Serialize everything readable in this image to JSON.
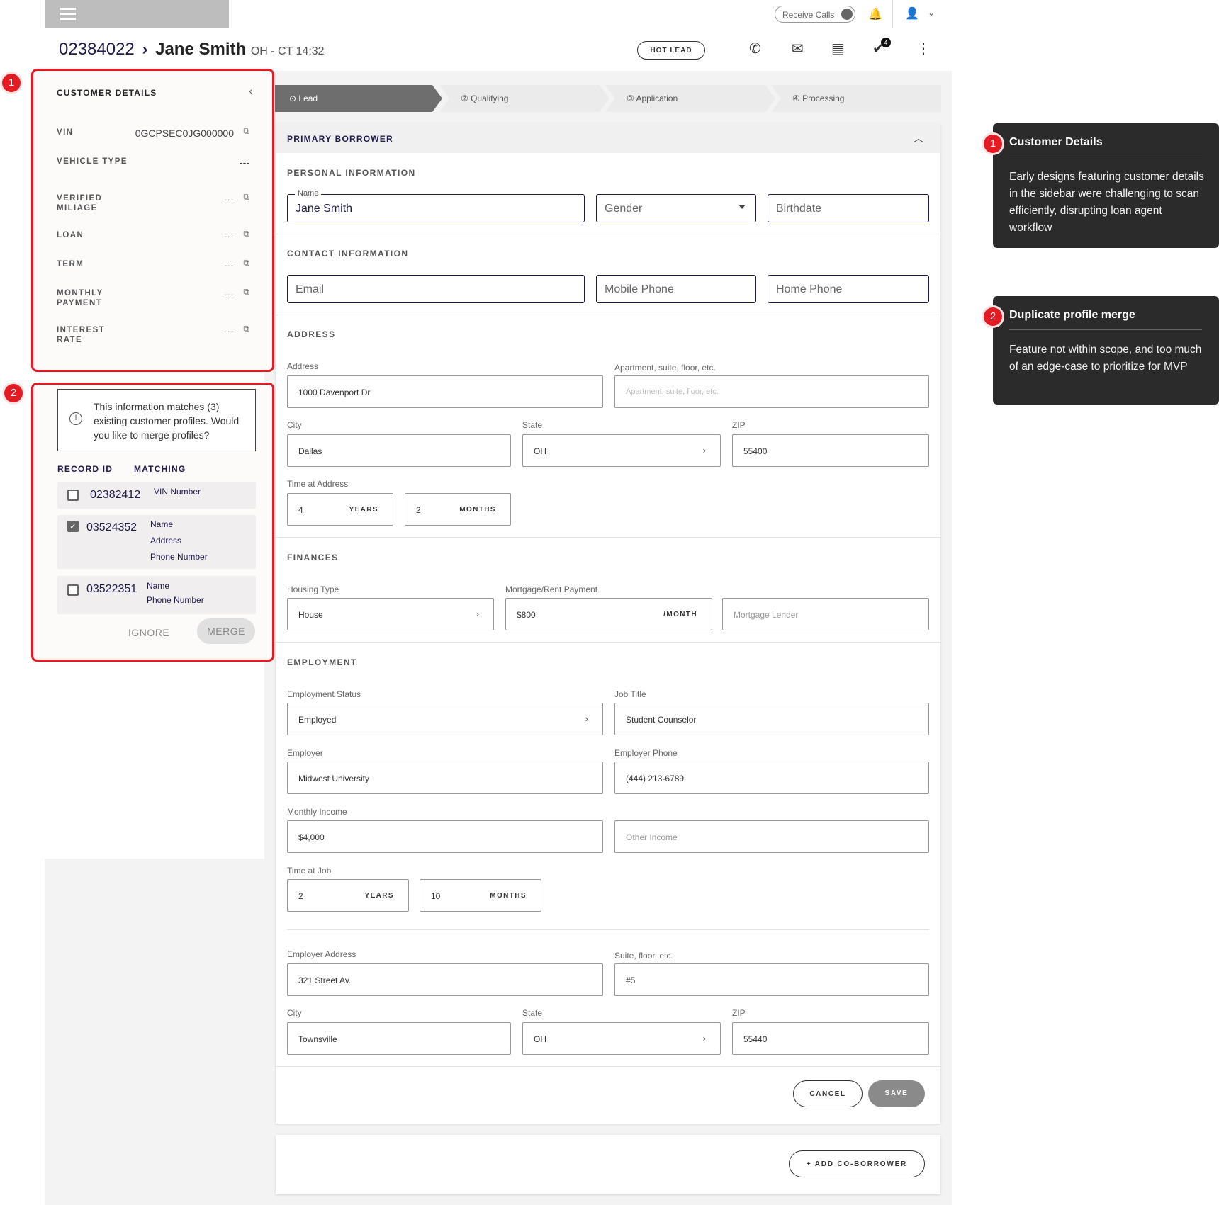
{
  "topbar": {
    "receive_calls": "Receive Calls"
  },
  "header": {
    "record_id": "02384022",
    "customer_name": "Jane Smith",
    "meta": "OH - CT 14:32",
    "hot_lead": "HOT LEAD",
    "task_count": "4"
  },
  "customer_details": {
    "title": "CUSTOMER DETAILS",
    "rows": [
      {
        "label": "VIN",
        "value": "0GCPSEC0JG000000"
      },
      {
        "label": "VEHICLE TYPE",
        "value": "---"
      },
      {
        "label": "VERIFIED MILIAGE",
        "value": "---"
      },
      {
        "label": "LOAN",
        "value": "---"
      },
      {
        "label": "TERM",
        "value": "---"
      },
      {
        "label": "MONTHLY PAYMENT",
        "value": "---"
      },
      {
        "label": "INTEREST RATE",
        "value": "---"
      }
    ]
  },
  "merge": {
    "message": "This information matches (3) existing customer profiles. Would you like to merge profiles?",
    "col_record": "RECORD ID",
    "col_matching": "MATCHING",
    "records": [
      {
        "id": "02382412",
        "checked": false,
        "matches": [
          "VIN Number"
        ]
      },
      {
        "id": "03524352",
        "checked": true,
        "matches": [
          "Name",
          "Address",
          "Phone Number"
        ]
      },
      {
        "id": "03522351",
        "checked": false,
        "matches": [
          "Name",
          "Phone Number"
        ]
      }
    ],
    "ignore": "IGNORE",
    "merge": "MERGE"
  },
  "badges": {
    "one": "1",
    "two": "2"
  },
  "stepper": [
    {
      "label": "Lead",
      "num": "✓",
      "active": true
    },
    {
      "label": "Qualifying",
      "num": "2",
      "active": false
    },
    {
      "label": "Application",
      "num": "3",
      "active": false
    },
    {
      "label": "Processing",
      "num": "4",
      "active": false
    }
  ],
  "form": {
    "section_title": "PRIMARY BORROWER",
    "personal": {
      "title": "PERSONAL INFORMATION",
      "name_label": "Name",
      "name_value": "Jane Smith",
      "gender_placeholder": "Gender",
      "birthdate_placeholder": "Birthdate"
    },
    "contact": {
      "title": "CONTACT INFORMATION",
      "email_placeholder": "Email",
      "mobile_placeholder": "Mobile Phone",
      "home_placeholder": "Home Phone"
    },
    "address": {
      "title": "ADDRESS",
      "address_label": "Address",
      "address_value": "1000 Davenport Dr",
      "apt_label": "Apartment, suite, floor, etc.",
      "apt_placeholder": "Apartment, suite, floor, etc.",
      "city_label": "City",
      "city_value": "Dallas",
      "state_label": "State",
      "state_value": "OH",
      "zip_label": "ZIP",
      "zip_value": "55400",
      "time_label": "Time at Address",
      "years_value": "4",
      "years_unit": "YEARS",
      "months_value": "2",
      "months_unit": "MONTHS"
    },
    "finances": {
      "title": "FINANCES",
      "housing_label": "Housing Type",
      "housing_value": "House",
      "payment_label": "Mortgage/Rent Payment",
      "payment_value": "$800",
      "payment_unit": "/MONTH",
      "lender_placeholder": "Mortgage Lender"
    },
    "employment": {
      "title": "EMPLOYMENT",
      "status_label": "Employment Status",
      "status_value": "Employed",
      "job_label": "Job Title",
      "job_value": "Student Counselor",
      "employer_label": "Employer",
      "employer_value": "Midwest University",
      "phone_label": "Employer Phone",
      "phone_value": "(444) 213-6789",
      "income_label": "Monthly Income",
      "income_value": "$4,000",
      "other_income_placeholder": "Other Income",
      "time_label": "Time at Job",
      "years_value": "2",
      "years_unit": "YEARS",
      "months_value": "10",
      "months_unit": "MONTHS",
      "emp_address_label": "Employer Address",
      "emp_address_value": "321 Street Av.",
      "suite_label": "Suite, floor, etc.",
      "suite_value": "#5",
      "city_label": "City",
      "city_value": "Townsville",
      "state_label": "State",
      "state_value": "OH",
      "zip_label": "ZIP",
      "zip_value": "55440"
    },
    "cancel": "CANCEL",
    "save": "SAVE",
    "add_coborrower": "+ ADD CO-BORROWER"
  },
  "annotations": [
    {
      "num": "1",
      "title": "Customer Details",
      "body": "Early designs featuring customer details in the sidebar were challenging to scan efficiently, disrupting loan agent workflow"
    },
    {
      "num": "2",
      "title": "Duplicate profile merge",
      "body": "Feature not within scope, and too much of an edge-case to prioritize for MVP"
    }
  ],
  "colors": {
    "accent": "#1f1b4d",
    "highlight": "#e31b23",
    "annotation_bg": "#2b2b2b"
  }
}
